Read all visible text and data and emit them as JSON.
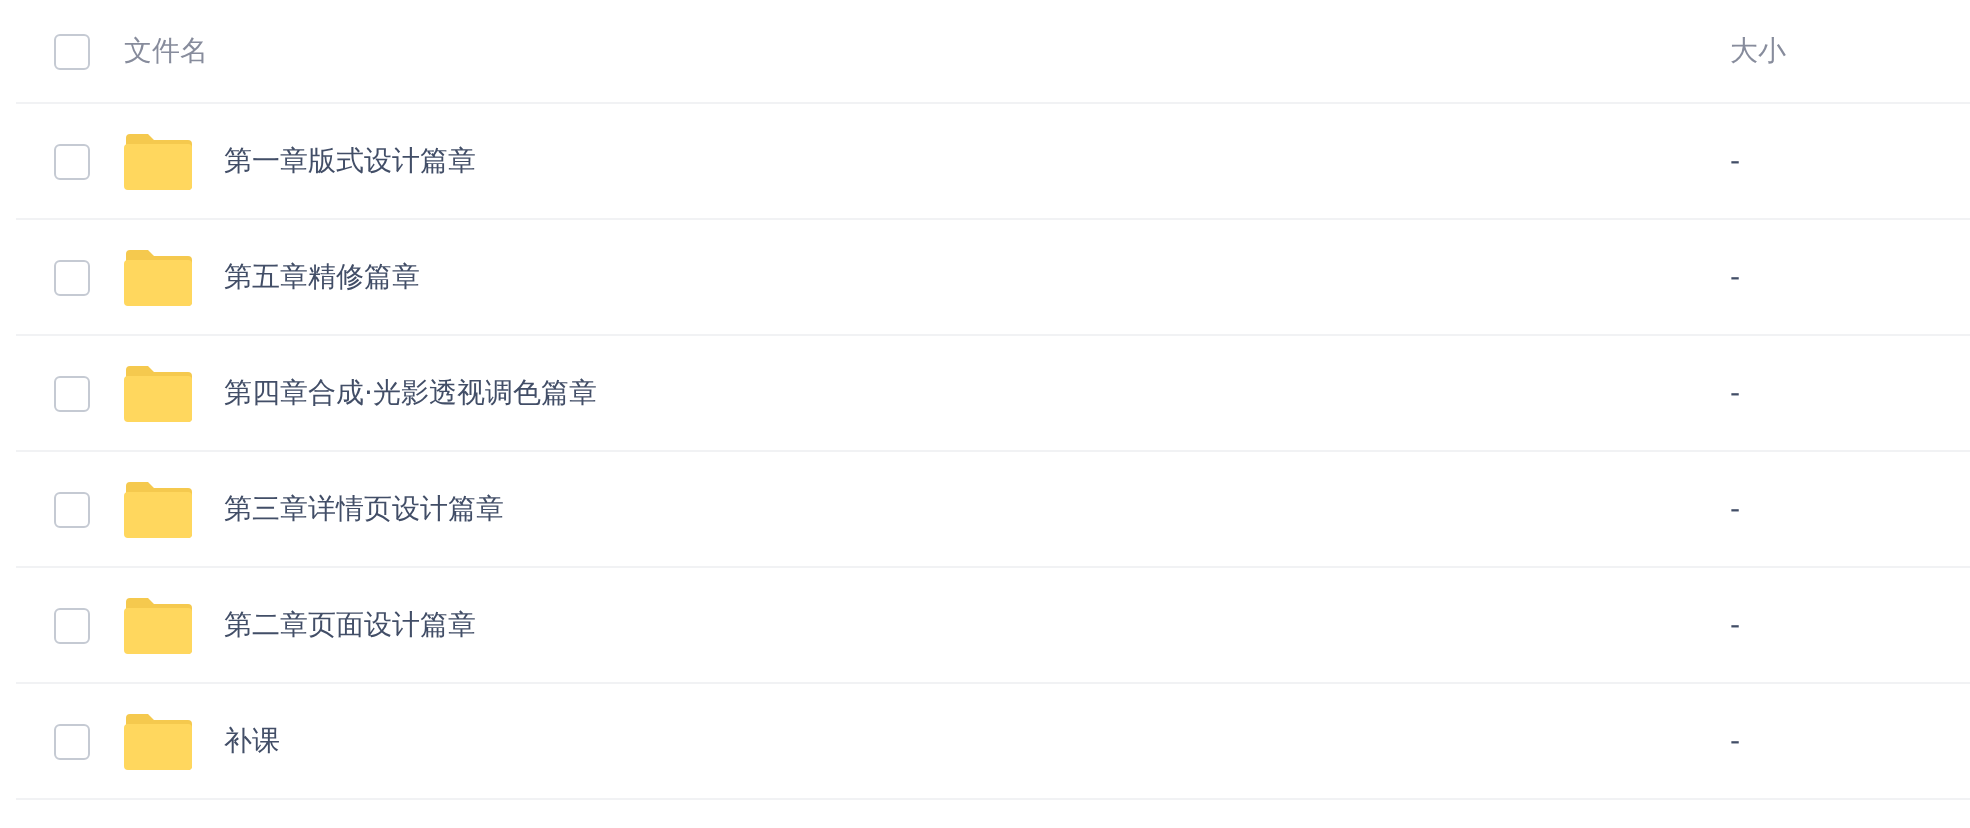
{
  "header": {
    "checked": false,
    "name_label": "文件名",
    "size_label": "大小"
  },
  "files": [
    {
      "name": "第一章版式设计篇章",
      "size": "-",
      "checked": false
    },
    {
      "name": "第五章精修篇章",
      "size": "-",
      "checked": false
    },
    {
      "name": "第四章合成·光影透视调色篇章",
      "size": "-",
      "checked": false
    },
    {
      "name": "第三章详情页设计篇章",
      "size": "-",
      "checked": false
    },
    {
      "name": "第二章页面设计篇章",
      "size": "-",
      "checked": false
    },
    {
      "name": "补课",
      "size": "-",
      "checked": false
    }
  ]
}
